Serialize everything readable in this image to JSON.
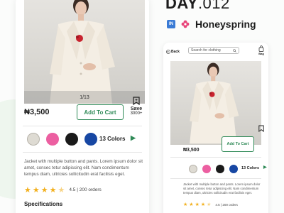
{
  "header": {
    "day_prefix": "DAY",
    "day_number": ".012",
    "app_badge": "IN",
    "brand_name": "Honeyspring"
  },
  "product": {
    "image_counter": "1/13",
    "price": "₦3,500",
    "add_to_cart": "Add To Cart",
    "save_label": "Save",
    "save_count": "3000+",
    "colors_label": "13 Colors",
    "swatches": [
      "#dedbd3",
      "#ec5fa1",
      "#1a1a1a",
      "#1747a3"
    ],
    "description": "Jacket with multiple button and pants. Lorem ipsum dolor sit amet, consec tetur adipiscing elit. Nam condimentum tempus diam, ultricies sollicitudin erat facilisis eget.",
    "rating": "4.5",
    "orders": "200 orders",
    "rating_line": "4.5 | 200 orders",
    "specifications": "Specifications"
  },
  "mobile_small": {
    "back": "Back",
    "search_placeholder": "Search for clothing",
    "bag": "Bag"
  },
  "colors": {
    "brand_green": "#2f8a57",
    "star": "#f2b01e"
  }
}
